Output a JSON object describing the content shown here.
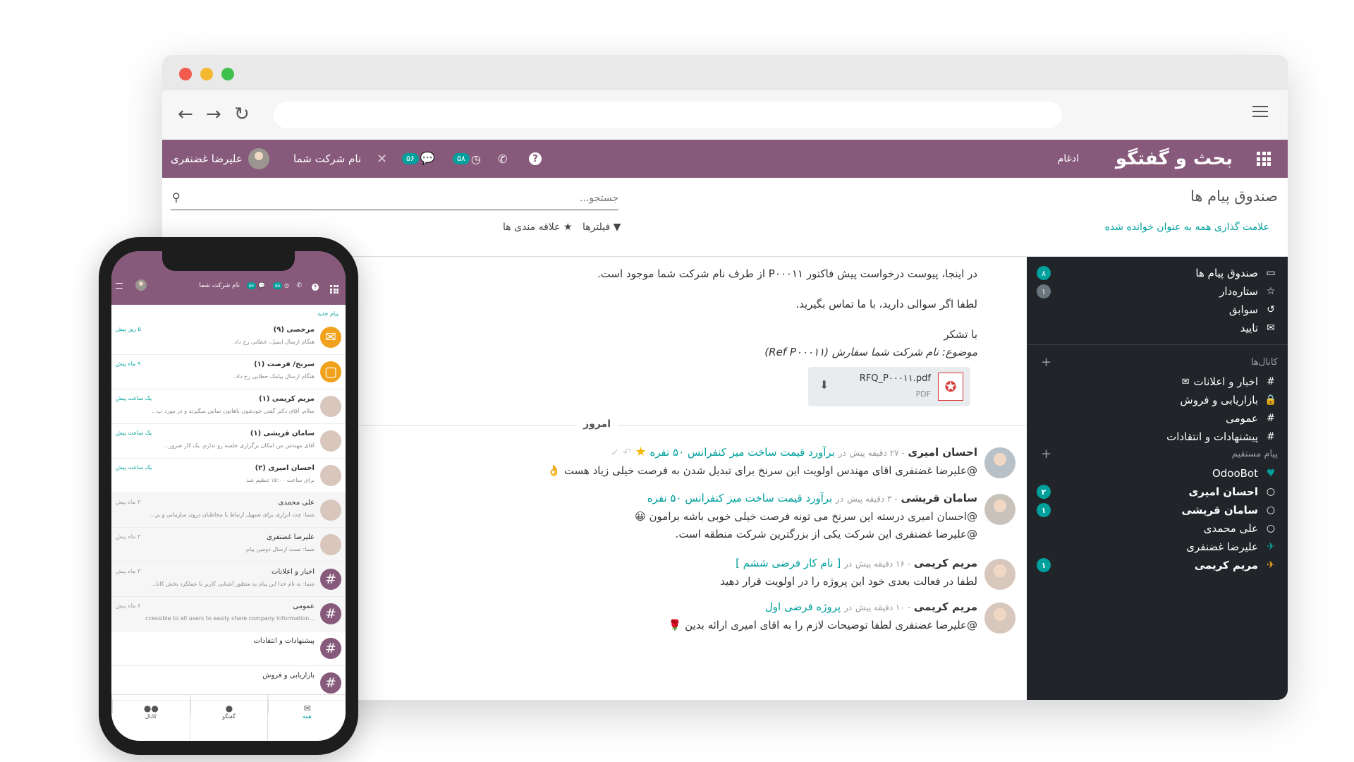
{
  "colors": {
    "brand": "#875a7b",
    "accent": "#00a09d",
    "sidebar": "#212529"
  },
  "topbar": {
    "app_title": "بحث و گفتگو",
    "menu_merge": "ادغام",
    "badge_activity": "۵۸",
    "badge_messages": "۵۶",
    "company": "نام شرکت شما",
    "user": "علیرضا غضنفری"
  },
  "control": {
    "breadcrumb": "صندوق پیام ها",
    "search_placeholder": "جستجو...",
    "mark_all_read": "علامت گذاری همه به عنوان خوانده شده",
    "filters": "فیلترها",
    "favorites": "علاقه مندی ها"
  },
  "sidebar": {
    "mailboxes": [
      {
        "label": "صندوق پیام ها",
        "icon": "inbox-icon",
        "count": "۸"
      },
      {
        "label": "ستاره‌دار",
        "icon": "star-icon",
        "count": "۱"
      },
      {
        "label": "سوابق",
        "icon": "history-icon",
        "count": ""
      },
      {
        "label": "تایید",
        "icon": "envelope-icon",
        "count": ""
      }
    ],
    "channels_title": "کانال‌ها",
    "channels": [
      {
        "label": "اخبار و اعلانات"
      },
      {
        "label": "بازاریابی و فروش"
      },
      {
        "label": "عمومی"
      },
      {
        "label": "پیشنهادات و انتقادات"
      }
    ],
    "direct_title": "پیام مستقیم",
    "direct": [
      {
        "label": "OdooBot",
        "count": ""
      },
      {
        "label": "احسان امیری",
        "count": "۲"
      },
      {
        "label": "سامان قریشی",
        "count": "۱"
      },
      {
        "label": "علی محمدی",
        "count": ""
      },
      {
        "label": "علیرضا غضنفری",
        "count": ""
      },
      {
        "label": "مریم کریمی",
        "count": "۱"
      }
    ]
  },
  "thread": {
    "intro_line1": "در اینجا، پیوست درخواست پیش فاکتور P۰۰۰۱۱ از طرف نام شرکت شما موجود است.",
    "intro_line2": "لطفا اگر سوالی دارید، با ما تماس بگیرید.",
    "thanks": "با تشکر",
    "subject": "موضوع: نام شرکت شما سفارش (Ref P۰۰۰۱۱)",
    "attachment": {
      "name": "RFQ_P۰۰۰۱۱.pdf",
      "type": "PDF"
    },
    "separator": "امروز",
    "messages": [
      {
        "author": "احسان امیری",
        "time": "- ۲۷ دقیقه پیش",
        "in": "در",
        "record": "برآورد قیمت ساخت میز کنفرانس ۵۰ نفره",
        "lines": [
          "@علیرضا غضنفری اقای مهندس اولویت این سرنخ برای تبدیل شدن به فرصت خیلی زیاد هست 👌"
        ]
      },
      {
        "author": "سامان قریشی",
        "time": "- ۳ دقیقه پیش",
        "in": "در",
        "record": "برآورد قیمت ساخت میز کنفرانس ۵۰ نفره",
        "lines": [
          "@احسان امیری درسته این سرنخ می تونه فرصت خیلی خوبی باشه برامون 😀",
          "@علیرضا غضنفری این شرکت یکی از بزرگترین شرکت منطقه است."
        ]
      },
      {
        "author": "مریم کریمی",
        "time": "- ۱۶ دقیقه پیش",
        "in": "در",
        "record": "[ نام کار فرضی ششم ]",
        "lines": [
          "لطفا در فعالت بعدی خود این پروژه را در اولویت قرار دهید"
        ]
      },
      {
        "author": "مریم کریمی",
        "time": "- ۱۰ دقیقه پیش",
        "in": "در",
        "record": "پروژه فرضی اول",
        "lines": [
          "@علیرضا غضنفری لطفا توضیحات لازم را به اقای امیری ارائه بدین 🌹"
        ]
      }
    ]
  },
  "mobile": {
    "company": "نام شرکت شما",
    "badge1": "۵۶",
    "badge2": "۵۸",
    "new_message": "پیام جدید",
    "items": [
      {
        "name": "مرخصی (۹)",
        "preview": "هنگام ارسال ایمیل، خطایی رخ داد.",
        "time": "۵ روز پیش",
        "color": "#f0a21d",
        "icon": "envelope-icon"
      },
      {
        "name": "سرنخ/ فرصت (۱)",
        "preview": "هنگام ارسال پیامک خطایی رخ داد.",
        "time": "۹ ماه پیش",
        "color": "#f0a21d",
        "icon": "sms-icon"
      },
      {
        "name": "مریم کریمی (۱)",
        "preview": "سلام، آقای دکتر گفتن خودشون باهاتون تماس میگیرند و در مورد پ...",
        "time": "یک ساعت پیش",
        "color": "#d9c6bd",
        "icon": "avatar"
      },
      {
        "name": "سامان قریشی (۱)",
        "preview": "آقای مهندس من امکان برگزاری جلسه رو ندارم، یک کار ضرور...",
        "time": "یک ساعت پیش",
        "color": "#d9c6bd",
        "icon": "avatar"
      },
      {
        "name": "احسان امیری (۲)",
        "preview": "برای ساعت ۱۵:۰۰ تنظیم شد",
        "time": "یک ساعت پیش",
        "color": "#d9c6bd",
        "icon": "avatar"
      },
      {
        "name": "علی محمدی",
        "preview": "شما: چت ابزاری برای تسهیل ارتباط با مخاطبان درون سازمانی و بر...",
        "time": "۳ ماه پیش",
        "color": "#d9c6bd",
        "icon": "avatar"
      },
      {
        "name": "علیرضا غضنفری",
        "preview": "شما: تست ارسال دومین پیام",
        "time": "۳ ماه پیش",
        "color": "#d9c6bd",
        "icon": "avatar"
      },
      {
        "name": "اخبار و اعلانات",
        "preview": "شما: به نام خدا این پیام به منظور آشنایی کاربر با عملکرد بخش کانا...",
        "time": "۳ ماه پیش",
        "color": "#875a7b",
        "icon": "hash-icon"
      },
      {
        "name": "عمومی",
        "preview": "...accessible to all users to easily share company information",
        "time": "۶ ماه پیش",
        "color": "#875a7b",
        "icon": "hash-icon"
      },
      {
        "name": "پیشنهادات و انتقادات",
        "preview": "",
        "time": "",
        "color": "#875a7b",
        "icon": "hash-icon"
      },
      {
        "name": "بازاریابی و فروش",
        "preview": "",
        "time": "",
        "color": "#875a7b",
        "icon": "hash-icon"
      }
    ],
    "tabs": [
      {
        "label": "همه"
      },
      {
        "label": "گفتگو"
      },
      {
        "label": "کانال"
      }
    ]
  }
}
